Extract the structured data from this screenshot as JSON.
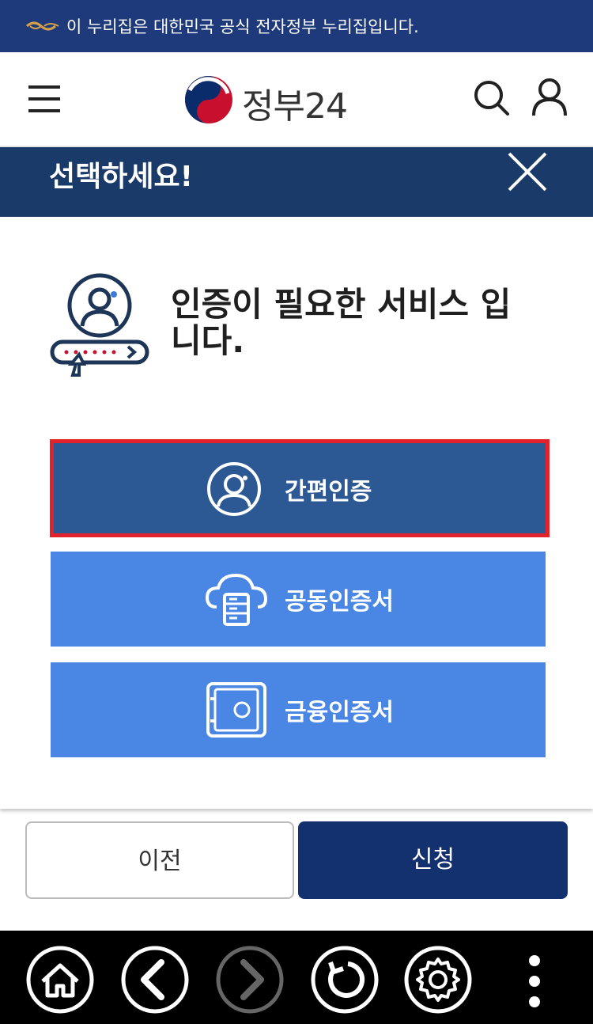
{
  "gov_banner": {
    "text": "이 누리집은 대한민국 공식 전자정부 누리집입니다."
  },
  "header": {
    "logo_text": "정부24",
    "icons": [
      "menu-icon",
      "search-icon",
      "user-icon"
    ]
  },
  "modal": {
    "title": "선택하세요!",
    "message": "인증이 필요한 서비스 입니다.",
    "options": [
      {
        "label": "간편인증",
        "icon": "user-circle-icon",
        "selected": true
      },
      {
        "label": "공동인증서",
        "icon": "cloud-server-icon",
        "selected": false
      },
      {
        "label": "금융인증서",
        "icon": "safe-icon",
        "selected": false
      }
    ]
  },
  "footer": {
    "prev_label": "이전",
    "apply_label": "신청"
  },
  "colors": {
    "banner": "#1e3a7a",
    "modal_header": "#1a3a6a",
    "option": "#4a86e3",
    "option_selected": "#2c5994",
    "selection_outline": "#e3222b",
    "apply_button": "#13306f"
  },
  "navbar": {
    "icons": [
      "home-icon",
      "back-icon",
      "forward-icon",
      "refresh-icon",
      "settings-icon",
      "more-icon"
    ]
  }
}
